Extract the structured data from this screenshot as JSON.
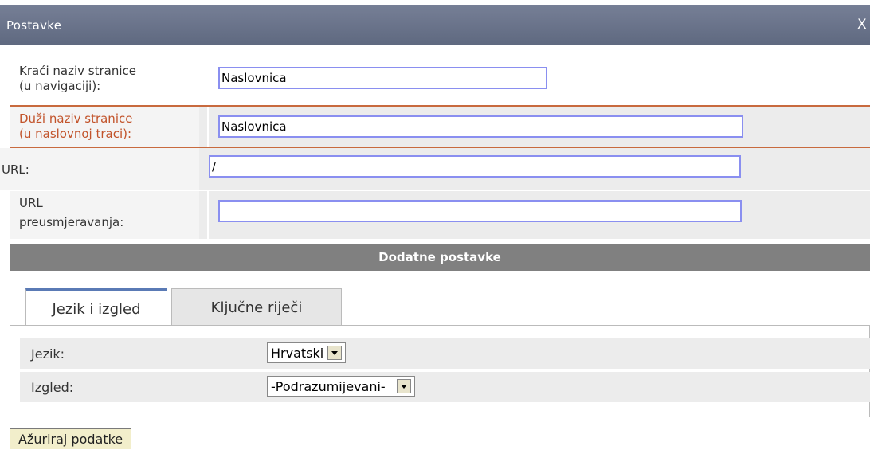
{
  "dialog": {
    "title": "Postavke",
    "close_label": "X"
  },
  "fields": {
    "short_name": {
      "label_1": "Kraći naziv stranice",
      "label_2": "(u navigaciji):",
      "value": "Naslovnica"
    },
    "long_name": {
      "label_1": "Duži naziv stranice",
      "label_2": "(u naslovnoj traci):",
      "value": "Naslovnica"
    },
    "url": {
      "label_1": "URL:",
      "value": "/"
    },
    "redirect_url": {
      "label_1": "URL",
      "label_2": "preusmjeravanja:",
      "value": ""
    }
  },
  "section": {
    "title": "Dodatne postavke"
  },
  "tabs": [
    {
      "label": "Jezik i izgled",
      "active": true
    },
    {
      "label": "Ključne riječi",
      "active": false
    }
  ],
  "panel": {
    "language": {
      "label": "Jezik:",
      "selected": "Hrvatski"
    },
    "layout": {
      "label": "Izgled:",
      "selected": "-Podrazumijevani-"
    }
  },
  "actions": {
    "submit_label": "Ažuriraj podatke"
  },
  "colors": {
    "titlebar": "#6b7490",
    "highlight": "#c86a3e",
    "section_bar": "#808080",
    "input_border": "#8a8ff0",
    "tab_active_accent": "#5a7ab5"
  }
}
